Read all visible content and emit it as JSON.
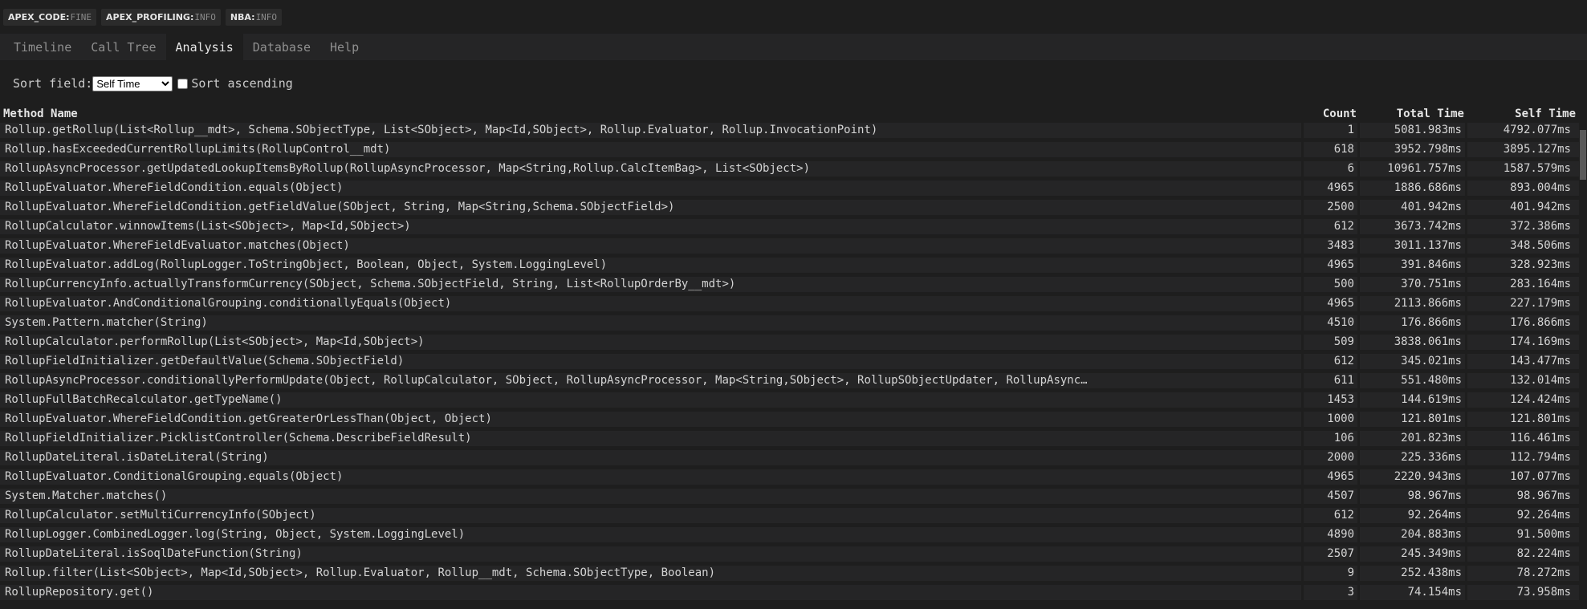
{
  "badges": [
    {
      "name": "APEX_CODE:",
      "level": "FINE"
    },
    {
      "name": "APEX_PROFILING:",
      "level": "INFO"
    },
    {
      "name": "NBA:",
      "level": "INFO"
    }
  ],
  "tabs": [
    {
      "label": "Timeline",
      "active": false
    },
    {
      "label": "Call Tree",
      "active": false
    },
    {
      "label": "Analysis",
      "active": true
    },
    {
      "label": "Database",
      "active": false
    },
    {
      "label": "Help",
      "active": false
    }
  ],
  "sort": {
    "label": "Sort field:",
    "selected": "Self Time",
    "ascending_label": "Sort ascending"
  },
  "table": {
    "headers": {
      "name": "Method Name",
      "count": "Count",
      "total": "Total Time",
      "self": "Self Time"
    },
    "rows": [
      {
        "name": "Rollup.getRollup(List<Rollup__mdt>, Schema.SObjectType, List<SObject>, Map<Id,SObject>, Rollup.Evaluator, Rollup.InvocationPoint)",
        "count": "1",
        "total": "5081.983ms",
        "self": "4792.077ms"
      },
      {
        "name": "Rollup.hasExceededCurrentRollupLimits(RollupControl__mdt)",
        "count": "618",
        "total": "3952.798ms",
        "self": "3895.127ms"
      },
      {
        "name": "RollupAsyncProcessor.getUpdatedLookupItemsByRollup(RollupAsyncProcessor, Map<String,Rollup.CalcItemBag>, List<SObject>)",
        "count": "6",
        "total": "10961.757ms",
        "self": "1587.579ms"
      },
      {
        "name": "RollupEvaluator.WhereFieldCondition.equals(Object)",
        "count": "4965",
        "total": "1886.686ms",
        "self": "893.004ms"
      },
      {
        "name": "RollupEvaluator.WhereFieldCondition.getFieldValue(SObject, String, Map<String,Schema.SObjectField>)",
        "count": "2500",
        "total": "401.942ms",
        "self": "401.942ms"
      },
      {
        "name": "RollupCalculator.winnowItems(List<SObject>, Map<Id,SObject>)",
        "count": "612",
        "total": "3673.742ms",
        "self": "372.386ms"
      },
      {
        "name": "RollupEvaluator.WhereFieldEvaluator.matches(Object)",
        "count": "3483",
        "total": "3011.137ms",
        "self": "348.506ms"
      },
      {
        "name": "RollupEvaluator.addLog(RollupLogger.ToStringObject, Boolean, Object, System.LoggingLevel)",
        "count": "4965",
        "total": "391.846ms",
        "self": "328.923ms"
      },
      {
        "name": "RollupCurrencyInfo.actuallyTransformCurrency(SObject, Schema.SObjectField, String, List<RollupOrderBy__mdt>)",
        "count": "500",
        "total": "370.751ms",
        "self": "283.164ms"
      },
      {
        "name": "RollupEvaluator.AndConditionalGrouping.conditionallyEquals(Object)",
        "count": "4965",
        "total": "2113.866ms",
        "self": "227.179ms"
      },
      {
        "name": "System.Pattern.matcher(String)",
        "count": "4510",
        "total": "176.866ms",
        "self": "176.866ms"
      },
      {
        "name": "RollupCalculator.performRollup(List<SObject>, Map<Id,SObject>)",
        "count": "509",
        "total": "3838.061ms",
        "self": "174.169ms"
      },
      {
        "name": "RollupFieldInitializer.getDefaultValue(Schema.SObjectField)",
        "count": "612",
        "total": "345.021ms",
        "self": "143.477ms"
      },
      {
        "name": "RollupAsyncProcessor.conditionallyPerformUpdate(Object, RollupCalculator, SObject, RollupAsyncProcessor, Map<String,SObject>, RollupSObjectUpdater, RollupAsync…",
        "count": "611",
        "total": "551.480ms",
        "self": "132.014ms"
      },
      {
        "name": "RollupFullBatchRecalculator.getTypeName()",
        "count": "1453",
        "total": "144.619ms",
        "self": "124.424ms"
      },
      {
        "name": "RollupEvaluator.WhereFieldCondition.getGreaterOrLessThan(Object, Object)",
        "count": "1000",
        "total": "121.801ms",
        "self": "121.801ms"
      },
      {
        "name": "RollupFieldInitializer.PicklistController(Schema.DescribeFieldResult)",
        "count": "106",
        "total": "201.823ms",
        "self": "116.461ms"
      },
      {
        "name": "RollupDateLiteral.isDateLiteral(String)",
        "count": "2000",
        "total": "225.336ms",
        "self": "112.794ms"
      },
      {
        "name": "RollupEvaluator.ConditionalGrouping.equals(Object)",
        "count": "4965",
        "total": "2220.943ms",
        "self": "107.077ms"
      },
      {
        "name": "System.Matcher.matches()",
        "count": "4507",
        "total": "98.967ms",
        "self": "98.967ms"
      },
      {
        "name": "RollupCalculator.setMultiCurrencyInfo(SObject)",
        "count": "612",
        "total": "92.264ms",
        "self": "92.264ms"
      },
      {
        "name": "RollupLogger.CombinedLogger.log(String, Object, System.LoggingLevel)",
        "count": "4890",
        "total": "204.883ms",
        "self": "91.500ms"
      },
      {
        "name": "RollupDateLiteral.isSoqlDateFunction(String)",
        "count": "2507",
        "total": "245.349ms",
        "self": "82.224ms"
      },
      {
        "name": "Rollup.filter(List<SObject>, Map<Id,SObject>, Rollup.Evaluator, Rollup__mdt, Schema.SObjectType, Boolean)",
        "count": "9",
        "total": "252.438ms",
        "self": "78.272ms"
      },
      {
        "name": "RollupRepository.get()",
        "count": "3",
        "total": "74.154ms",
        "self": "73.958ms"
      }
    ]
  }
}
